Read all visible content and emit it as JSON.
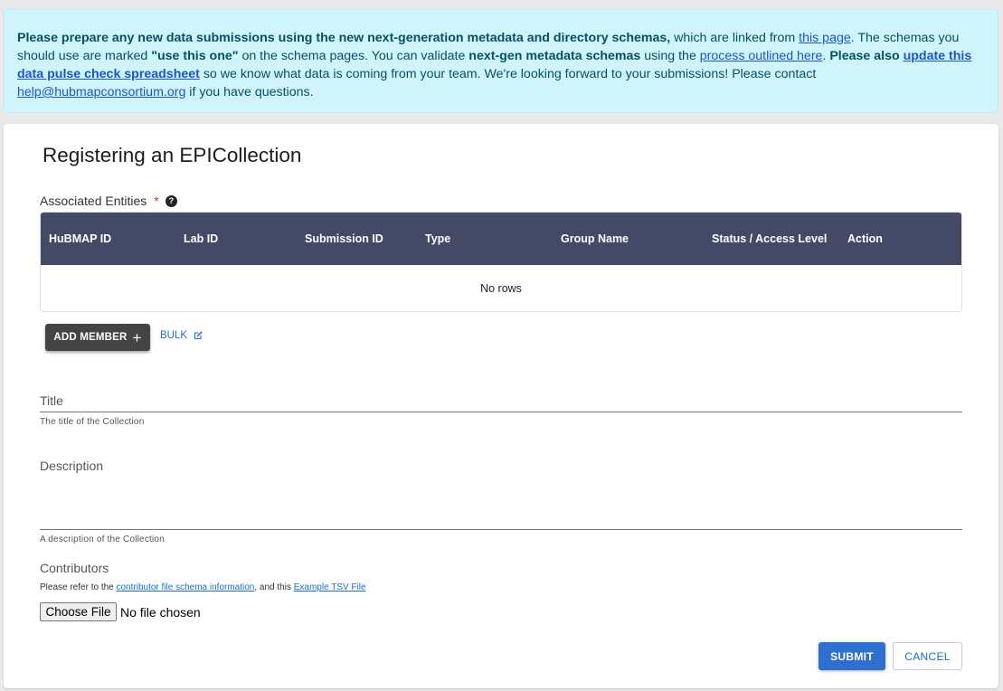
{
  "banner": {
    "part1": "Please prepare any new data submissions using the new next-generation metadata and directory schemas,",
    "part2": " which are linked from ",
    "link1": "this page",
    "part3": ". The schemas you should use are marked ",
    "part4": "\"use this one\"",
    "part5": " on the schema pages. You can validate ",
    "part6": "next-gen metadata schemas",
    "part7": " using the ",
    "link2": "process outlined here",
    "part8": ". ",
    "part9": "Please also ",
    "link3": "update this data pulse check spreadsheet",
    "part10": " so we know what data is coming from your team. We're looking forward to your submissions! Please contact ",
    "link4": "help@hubmapconsortium.org",
    "part11": " if you have questions."
  },
  "form": {
    "title": "Registering an EPICollection",
    "associated_label": "Associated Entities",
    "required_mark": "*",
    "help_glyph": "?",
    "table": {
      "columns": [
        "HuBMAP ID",
        "Lab ID",
        "Submission ID",
        "Type",
        "Group Name",
        "Status / Access Level",
        "Action"
      ],
      "empty_text": "No rows"
    },
    "add_member_label": "ADD MEMBER",
    "add_member_icon": "plus-icon",
    "bulk_label": "BULK",
    "bulk_icon": "edit-icon",
    "title_field": {
      "label": "Title",
      "helper": "The title of the Collection"
    },
    "description_field": {
      "label": "Description",
      "helper": "A description of the Collection"
    },
    "contributors": {
      "label": "Contributors",
      "note_prefix": "Please refer to the ",
      "note_link1": "contributor file schema information",
      "note_mid": ", and this ",
      "note_link2": "Example TSV File",
      "choose_file_label": "Choose File",
      "no_file_text": "No file chosen"
    },
    "submit_label": "SUBMIT",
    "cancel_label": "CANCEL"
  },
  "colors": {
    "banner_bg": "#cff4fc",
    "table_header": "#444a65",
    "primary": "#2f6fcf"
  }
}
